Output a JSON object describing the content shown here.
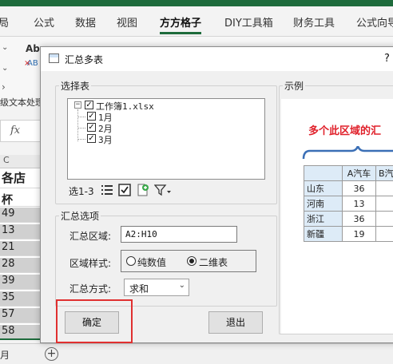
{
  "ribbon": {
    "tabs": [
      "局",
      "公式",
      "数据",
      "视图",
      "方方格子",
      "DIY工具箱",
      "财务工具",
      "公式向导"
    ],
    "active_tab": "方方格子",
    "partial_labels": [
      "Ab",
      "AB",
      "级文本处理"
    ]
  },
  "formula_bar": {
    "fx": "fx"
  },
  "sheet": {
    "col_header": "C",
    "cells": [
      "各店",
      "杯",
      "49",
      "13",
      "21",
      "28",
      "39",
      "35",
      "57",
      "58"
    ],
    "tab_label": "月",
    "add_sheet": "+"
  },
  "dialog": {
    "title": "汇总多表",
    "help": "?",
    "select_group": {
      "legend": "选择表",
      "tree": {
        "root": "工作簿1.xlsx",
        "children": [
          "1月",
          "2月",
          "3月"
        ]
      },
      "toolbar_label": "选1-3"
    },
    "options_group": {
      "legend": "汇总选项",
      "range_label": "汇总区域:",
      "range_value": "A2:H10",
      "style_label": "区域样式:",
      "style_options": [
        "纯数值",
        "二维表"
      ],
      "style_selected": "二维表",
      "method_label": "汇总方式:",
      "method_value": "求和"
    },
    "ok_label": "确定",
    "exit_label": "退出",
    "example": {
      "legend": "示例",
      "caption": "多个此区域的汇",
      "headers": [
        "A汽车",
        "B汽"
      ],
      "rows": [
        {
          "name": "山东",
          "value": "36"
        },
        {
          "name": "河南",
          "value": "13"
        },
        {
          "name": "浙江",
          "value": "36"
        },
        {
          "name": "新疆",
          "value": "19"
        }
      ]
    }
  },
  "colors": {
    "excel_green": "#1e6b3c",
    "highlight_red": "#e03030",
    "caption_red": "#e0202a",
    "header_blue": "#ddebf7"
  }
}
